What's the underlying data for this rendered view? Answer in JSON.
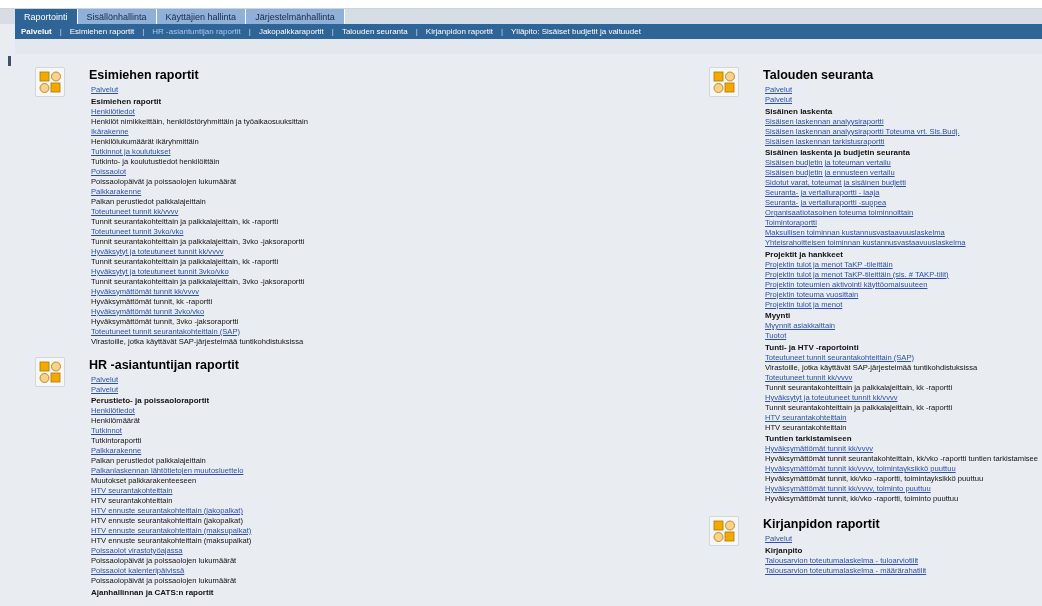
{
  "tabs": [
    {
      "label": "Raportointi",
      "selected": true
    },
    {
      "label": "Sisällönhallinta",
      "selected": false
    },
    {
      "label": "Käyttäjien hallinta",
      "selected": false
    },
    {
      "label": "Järjestelmänhallinta",
      "selected": false
    }
  ],
  "nav": [
    {
      "kind": "link",
      "label": "Palvelut",
      "selected": false,
      "bold": true
    },
    {
      "kind": "separator",
      "label": "|"
    },
    {
      "kind": "link",
      "label": "Esimiehen raportit",
      "selected": false,
      "bold": false
    },
    {
      "kind": "separator",
      "label": "|"
    },
    {
      "kind": "link",
      "label": "HR -asiantuntijan raportit",
      "selected": true,
      "bold": false
    },
    {
      "kind": "separator",
      "label": "|"
    },
    {
      "kind": "link",
      "label": "Jakopalkkaraportit",
      "selected": false,
      "bold": false
    },
    {
      "kind": "separator",
      "label": "|"
    },
    {
      "kind": "link",
      "label": "Talouden seuranta",
      "selected": false,
      "bold": false
    },
    {
      "kind": "separator",
      "label": "|"
    },
    {
      "kind": "link",
      "label": "Kirjanpidon raportit",
      "selected": false,
      "bold": false
    },
    {
      "kind": "separator",
      "label": "|"
    },
    {
      "kind": "link",
      "label": "Ylläpito: Sisäiset budjetit ja valtuudet",
      "selected": false,
      "bold": false
    }
  ],
  "columns": [
    [
      {
        "title": "Esimiehen raportit",
        "lines": [
          {
            "kind": "link",
            "text": "Palvelut"
          },
          {
            "kind": "heading",
            "text": "Esimiehen raportit"
          },
          {
            "kind": "link",
            "text": "Henkilötiedot"
          },
          {
            "kind": "text",
            "text": "Henkilöt nimikkeittäin, henkilöstöryhmittäin ja työaikaosuuksittain"
          },
          {
            "kind": "link",
            "text": "Ikärakenne"
          },
          {
            "kind": "text",
            "text": "Henkilölukumäärät ikäryhmittäin"
          },
          {
            "kind": "link",
            "text": "Tutkinnot ja koulutukset"
          },
          {
            "kind": "text",
            "text": "Tutkinto- ja koulutustiedot henkilöittäin"
          },
          {
            "kind": "link",
            "text": "Poissaolot"
          },
          {
            "kind": "text",
            "text": "Poissaolopäivät ja poissaolojen lukumäärät"
          },
          {
            "kind": "link",
            "text": "Palkkarakenne"
          },
          {
            "kind": "text",
            "text": "Palkan perustiedot palkkalajeittain"
          },
          {
            "kind": "link",
            "text": "Toteutuneet tunnit kk/vvvv"
          },
          {
            "kind": "text",
            "text": "Tunnit seurantakohteittain ja palkkalajeittain, kk -raportti"
          },
          {
            "kind": "link",
            "text": "Toteutuneet tunnit 3vko/vko"
          },
          {
            "kind": "text",
            "text": "Tunnit seurantakohteittain ja palkkalajeittain, 3vko -jaksoraportti"
          },
          {
            "kind": "link",
            "text": "Hyväksytyt ja toteutuneet tunnit kk/vvvv"
          },
          {
            "kind": "text",
            "text": "Tunnit seurantakohteittain ja palkkalajeittain, kk -raportti"
          },
          {
            "kind": "link",
            "text": "Hyväksytyt ja toteutuneet tunnit 3vko/vko"
          },
          {
            "kind": "text",
            "text": "Tunnit seurantakohteittain ja palkkalajeittain, 3vko -jaksoraportti"
          },
          {
            "kind": "link",
            "text": "Hyväksymättömät tunnit kk/vvvv"
          },
          {
            "kind": "text",
            "text": "Hyväksymättömät tunnit, kk -raportti"
          },
          {
            "kind": "link",
            "text": "Hyväksymättömät tunnit 3vko/vko"
          },
          {
            "kind": "text",
            "text": "Hyväksymättömät tunnit, 3vko -jaksoraportti"
          },
          {
            "kind": "link",
            "text": "Toteutuneet tunnit seurantakohteittain (SAP)"
          },
          {
            "kind": "text",
            "text": "Virastoille, jotka käyttävät SAP-järjestelmää tuntikohdistuksissa"
          }
        ]
      },
      {
        "title": "HR -asiantuntijan raportit",
        "lines": [
          {
            "kind": "link",
            "text": "Palvelut"
          },
          {
            "kind": "link",
            "text": "Palvelut"
          },
          {
            "kind": "heading",
            "text": "Perustieto- ja poissaoloraportit"
          },
          {
            "kind": "link",
            "text": "Henkilötiedot"
          },
          {
            "kind": "text",
            "text": "Henkilömäärät"
          },
          {
            "kind": "link",
            "text": "Tutkinnot"
          },
          {
            "kind": "text",
            "text": "Tutkintoraportti"
          },
          {
            "kind": "link",
            "text": "Palkkarakenne"
          },
          {
            "kind": "text",
            "text": "Palkan perustiedot palkkalajeittain"
          },
          {
            "kind": "link",
            "text": "Palkanlaskennan lähtötietojen muutosluettelo"
          },
          {
            "kind": "text",
            "text": "Muutokset palkkarakenteeseen"
          },
          {
            "kind": "link",
            "text": "HTV seurantakohteittain"
          },
          {
            "kind": "text",
            "text": "HTV seurantakohteittain"
          },
          {
            "kind": "link",
            "text": "HTV ennuste seurantakohteittain (jakopalkat)"
          },
          {
            "kind": "text",
            "text": "HTV ennuste seurantakohteittain (jakopalkat)"
          },
          {
            "kind": "link",
            "text": "HTV ennuste seurantakohteittain (maksupalkat)"
          },
          {
            "kind": "text",
            "text": "HTV ennuste seurantakohteittain (maksupalkat)"
          },
          {
            "kind": "link",
            "text": "Poissaolot virastotyöajassa"
          },
          {
            "kind": "text",
            "text": "Poissaolopäivät ja poissaolojen lukumäärät"
          },
          {
            "kind": "link",
            "text": "Poissaolot kalenteripäivissä"
          },
          {
            "kind": "text",
            "text": "Poissaolopäivät ja poissaolojen lukumäärät"
          },
          {
            "kind": "heading",
            "text": "Ajanhallinnan ja CATS:n raportit"
          }
        ]
      }
    ],
    [
      {
        "title": "Talouden seuranta",
        "lines": [
          {
            "kind": "link",
            "text": "Palvelut"
          },
          {
            "kind": "link",
            "text": "Palvelut"
          },
          {
            "kind": "heading",
            "text": "Sisäinen laskenta"
          },
          {
            "kind": "link",
            "text": "Sisäisen laskennan analyysiraportti"
          },
          {
            "kind": "link",
            "text": "Sisäisen laskennan analyysiraportti Toteuma vrt. Sis.Budj."
          },
          {
            "kind": "link",
            "text": "Sisäisen laskennan tarkistusraportti"
          },
          {
            "kind": "heading",
            "text": "Sisäinen laskenta ja budjetin seuranta"
          },
          {
            "kind": "link",
            "text": "Sisäisen budjetin ja toteuman vertailu"
          },
          {
            "kind": "link",
            "text": "Sisäisen budjetin ja ennusteen vertailu"
          },
          {
            "kind": "link",
            "text": "Sidotut varat, toteumat ja sisäinen budjetti"
          },
          {
            "kind": "link",
            "text": "Seuranta- ja vertailuraportti - laaja"
          },
          {
            "kind": "link",
            "text": "Seuranta- ja vertailuraportti -suppea"
          },
          {
            "kind": "link",
            "text": "Organisaatiotasoinen toteuma toiminnoittain"
          },
          {
            "kind": "link",
            "text": "Toimintoraportti"
          },
          {
            "kind": "link",
            "text": "Maksullisen toiminnan kustannusvastaavuuslaskelma"
          },
          {
            "kind": "link",
            "text": "Yhteisrahoitteisen toiminnan kustannusvastaavuuslaskelma"
          },
          {
            "kind": "heading",
            "text": "Projektit ja hankkeet"
          },
          {
            "kind": "link",
            "text": "Projektin tulot ja menot TaKP -tileittäin"
          },
          {
            "kind": "link",
            "text": "Projektin tulot ja menot TaKP-tileittäin (sis. # TAKP-tilit)"
          },
          {
            "kind": "link",
            "text": "Projektin toteumien aktivointi käyttöomaisuuteen"
          },
          {
            "kind": "link",
            "text": "Projektin toteuma vuosittain"
          },
          {
            "kind": "link",
            "text": "Projektin tulot ja menot"
          },
          {
            "kind": "heading",
            "text": "Myynti"
          },
          {
            "kind": "link",
            "text": "Myynnit asiakkaittain"
          },
          {
            "kind": "link",
            "text": "Tuotot"
          },
          {
            "kind": "heading",
            "text": "Tunti- ja HTV -raportointi"
          },
          {
            "kind": "link",
            "text": "Toteutuneet tunnit seurantakohteittain (SAP)"
          },
          {
            "kind": "text",
            "text": "Virastoille, jotka käyttävät SAP-järjestelmää tuntikohdistuksissa"
          },
          {
            "kind": "link",
            "text": "Toteutuneet tunnit kk/vvvv"
          },
          {
            "kind": "text",
            "text": "Tunnit seurantakohteittain ja palkkalajeittain, kk -raportti"
          },
          {
            "kind": "link",
            "text": "Hyväksytyt ja toteutuneet tunnit kk/vvvv"
          },
          {
            "kind": "text",
            "text": "Tunnit seurantakohteittain ja palkkalajeittain, kk -raportti"
          },
          {
            "kind": "link",
            "text": "HTV seurantakohteittain"
          },
          {
            "kind": "text",
            "text": "HTV seurantakohteittain"
          },
          {
            "kind": "heading",
            "text": "Tuntien tarkistamiseen"
          },
          {
            "kind": "link",
            "text": "Hyväksymättömät tunnit kk/vvvv"
          },
          {
            "kind": "text",
            "text": "Hyväksymättömät tunnit seurantakohteittain, kk/vko -raportti tuntien tarkistamisee"
          },
          {
            "kind": "link",
            "text": "Hyväksymättömät tunnit kk/vvvv, toimintayksikkö puuttuu"
          },
          {
            "kind": "text",
            "text": "Hyväksymättömät tunnit, kk/vko -raportti, toimintayksikkö puuttuu"
          },
          {
            "kind": "link",
            "text": "Hyväksymättömät tunnit kk/vvvv, toiminto puuttuu"
          },
          {
            "kind": "text",
            "text": "Hyväksymättömät tunnit, kk/vko -raportti, toiminto puuttuu"
          }
        ]
      },
      {
        "title": "Kirjanpidon raportit",
        "lines": [
          {
            "kind": "link",
            "text": "Palvelut"
          },
          {
            "kind": "heading",
            "text": "Kirjanpito"
          },
          {
            "kind": "link",
            "text": "Talousarvion toteutumalaskelma - tuloarviotilit"
          },
          {
            "kind": "link",
            "text": "Talousarvion toteutumalaskelma - määrärahatilit"
          }
        ]
      }
    ]
  ]
}
